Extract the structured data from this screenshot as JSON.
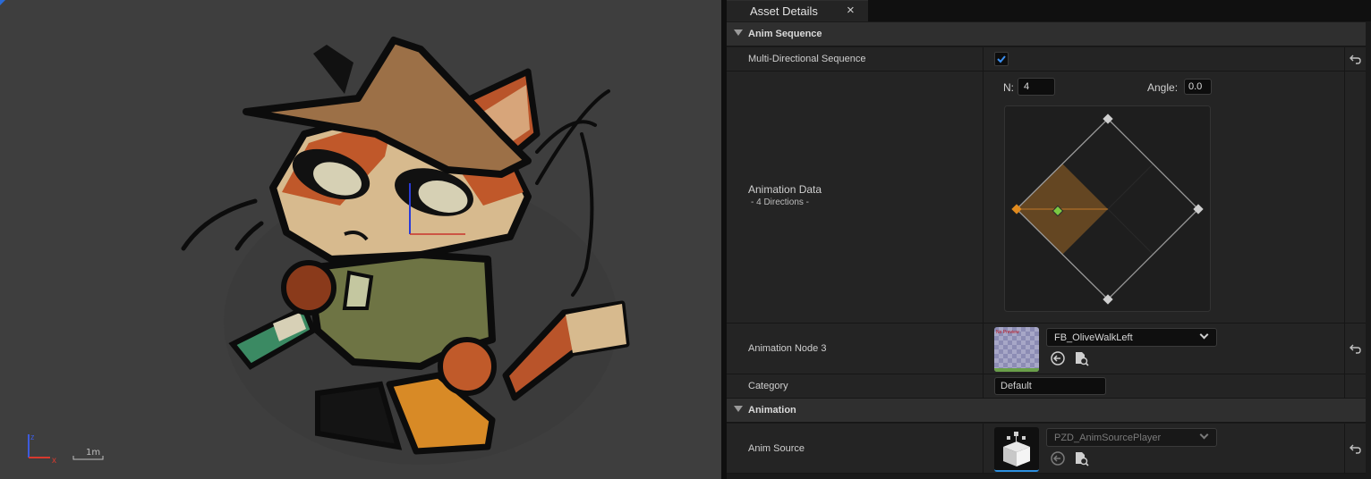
{
  "viewport": {
    "scale_label": "1m",
    "axis_labels": {
      "x": "x",
      "z": "z"
    }
  },
  "details": {
    "tab": {
      "title": "Asset Details",
      "close": "×"
    },
    "categories": {
      "anim_sequence": "Anim Sequence",
      "animation": "Animation"
    },
    "rows": {
      "multi_directional": {
        "label": "Multi-Directional Sequence",
        "checked": true
      },
      "animation_data": {
        "label": "Animation Data",
        "sublabel": "- 4 Directions -",
        "n_label": "N:",
        "n_value": "4",
        "angle_label": "Angle:",
        "angle_value": "0.0"
      },
      "animation_node_3": {
        "label": "Animation Node 3",
        "asset": "FB_OliveWalkLeft",
        "thumb_text": "No Preview"
      },
      "category": {
        "label": "Category",
        "value": "Default"
      },
      "anim_source": {
        "label": "Anim Source",
        "asset": "PZD_AnimSourcePlayer"
      }
    }
  },
  "colors": {
    "accent_blue": "#2a6bd8",
    "direction_orange": "#e08a1e",
    "direction_green": "#7ac943",
    "sector_fill": "#6b4a22"
  }
}
